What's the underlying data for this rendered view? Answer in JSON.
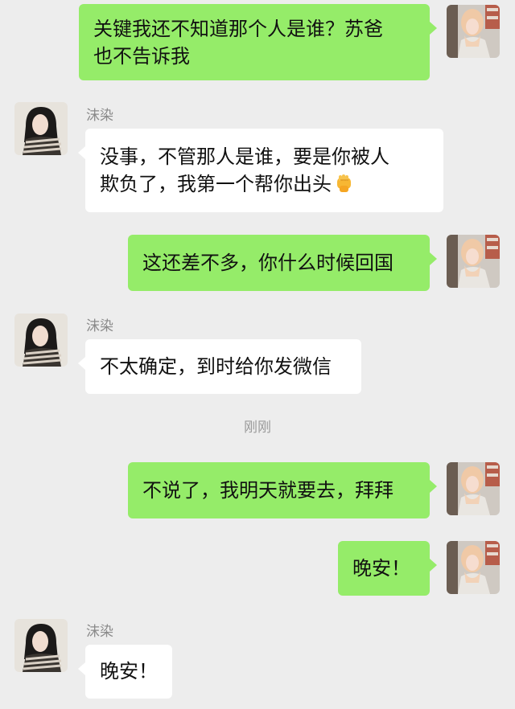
{
  "chat": {
    "timestamp": "刚刚",
    "contact_name": "沫染",
    "messages": [
      {
        "side": "out",
        "lines": [
          "关键我还不知道那个人是谁？苏爸",
          "也不告诉我"
        ]
      },
      {
        "side": "in",
        "name": "沫染",
        "lines": [
          "没事，不管那人是谁，要是你被人",
          "欺负了，我第一个帮你出头"
        ],
        "emoji": "fist-icon"
      },
      {
        "side": "out",
        "lines": [
          "这还差不多，你什么时候回国"
        ]
      },
      {
        "side": "in",
        "name": "沫染",
        "lines": [
          "不太确定，到时给你发微信"
        ]
      },
      {
        "side": "out",
        "lines": [
          "不说了，我明天就要去，拜拜"
        ]
      },
      {
        "side": "out",
        "lines": [
          "晚安！"
        ]
      },
      {
        "side": "in",
        "name": "沫染",
        "lines": [
          "晚安！"
        ]
      }
    ]
  },
  "colors": {
    "background": "#ededed",
    "outgoing_bubble": "#95ec69",
    "incoming_bubble": "#ffffff"
  }
}
